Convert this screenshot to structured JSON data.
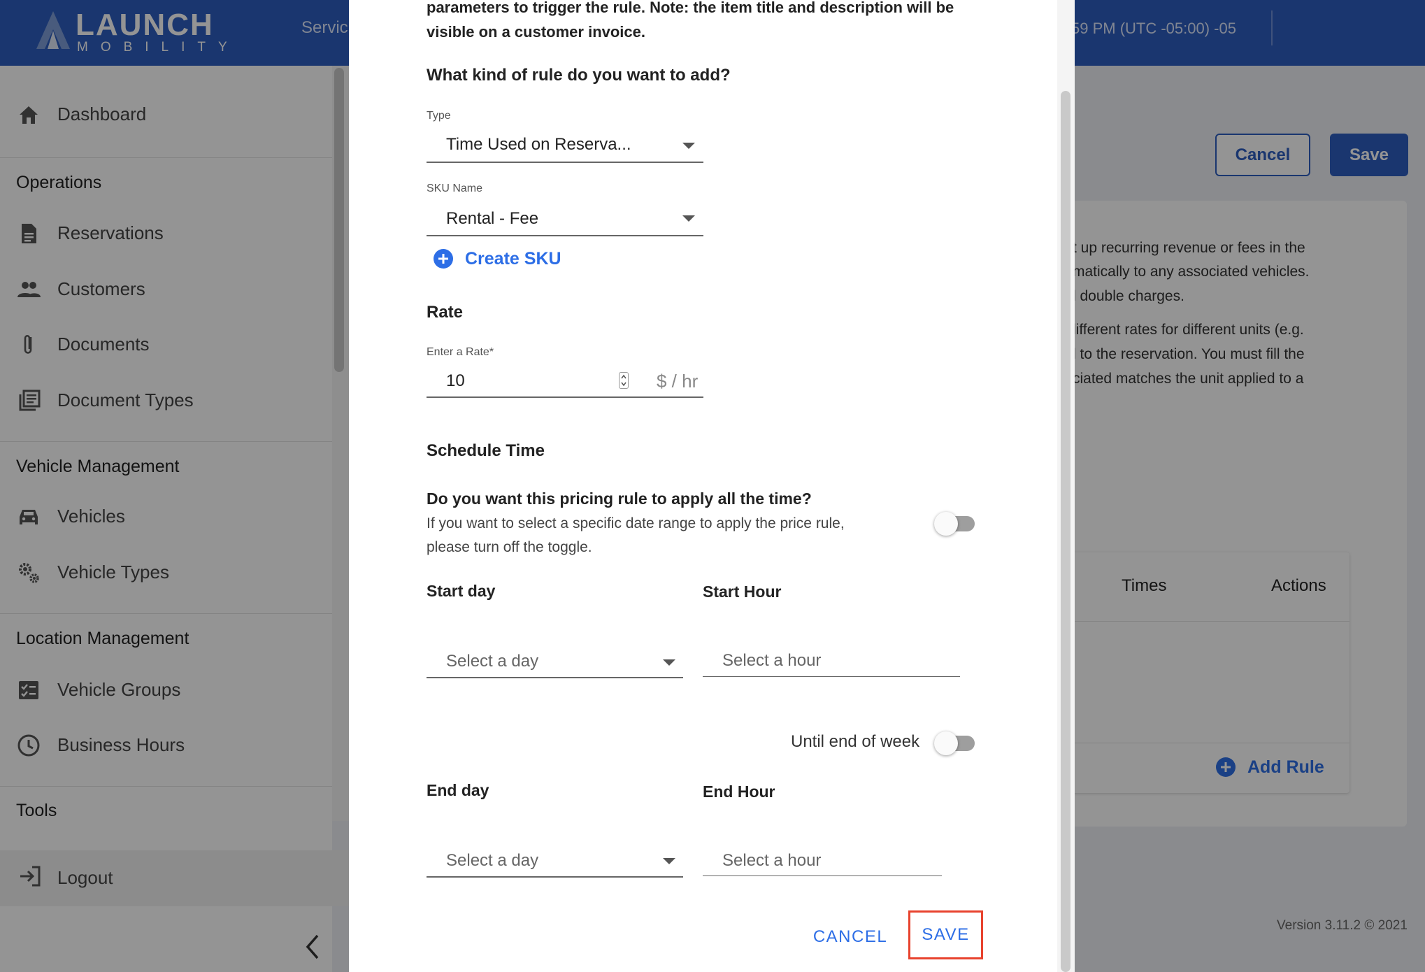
{
  "header": {
    "logo_word": "LAUNCH",
    "logo_sub": "MOBILITY",
    "service_text": "Servic",
    "time_text": "59 PM (UTC -05:00) -05",
    "brand_color": "#2d5ebf"
  },
  "sidebar": {
    "dashboard": "Dashboard",
    "operations_heading": "Operations",
    "operations_items": [
      {
        "label": "Reservations",
        "icon": "document-icon"
      },
      {
        "label": "Customers",
        "icon": "people-icon"
      },
      {
        "label": "Documents",
        "icon": "paperclip-icon"
      },
      {
        "label": "Document Types",
        "icon": "library-icon"
      }
    ],
    "vehicle_heading": "Vehicle Management",
    "vehicle_items": [
      {
        "label": "Vehicles",
        "icon": "car-icon"
      },
      {
        "label": "Vehicle Types",
        "icon": "gears-icon"
      }
    ],
    "location_heading": "Location Management",
    "location_items": [
      {
        "label": "Vehicle Groups",
        "icon": "checklist-icon"
      },
      {
        "label": "Business Hours",
        "icon": "clock-icon"
      }
    ],
    "tools_heading": "Tools",
    "logout": "Logout"
  },
  "background_page": {
    "cancel_label": "Cancel",
    "save_label": "Save",
    "description_lines": [
      "t up recurring revenue or fees in the",
      "matically to any associated vehicles.",
      "l double charges.",
      "lifferent rates for different units (e.g.",
      "l to the reservation. You must fill the",
      "ciated matches the unit applied to a"
    ],
    "table_headers": {
      "times": "Times",
      "actions": "Actions"
    },
    "add_rule_label": "Add Rule",
    "version": "Version 3.11.2 © 2021"
  },
  "modal": {
    "intro_lines": [
      "parameters to trigger the rule. Note: the item title and description will be",
      "visible on a customer invoice."
    ],
    "rule_kind_heading": "What kind of rule do you want to add?",
    "type_label": "Type",
    "type_value": "Time Used on Reserva...",
    "sku_label": "SKU Name",
    "sku_value": "Rental - Fee",
    "create_sku_label": "Create SKU",
    "rate_heading": "Rate",
    "rate_label": "Enter a Rate*",
    "rate_value": "10",
    "rate_unit": "$ / hr",
    "schedule_heading": "Schedule Time",
    "apply_question": "Do you want this pricing rule to apply all the time?",
    "apply_desc_lines": [
      "If you want to select a specific date range to apply the price rule,",
      "please turn off the toggle."
    ],
    "apply_all_time_on": false,
    "start_day_heading": "Start day",
    "start_day_placeholder": "Select a day",
    "start_hour_heading": "Start Hour",
    "start_hour_placeholder": "Select a hour",
    "until_end_label": "Until end of week",
    "until_end_on": false,
    "end_day_heading": "End day",
    "end_day_placeholder": "Select a day",
    "end_hour_heading": "End Hour",
    "end_hour_placeholder": "Select a hour",
    "cancel_label": "CANCEL",
    "save_label": "SAVE",
    "highlight_color": "#e8432e",
    "link_color": "#2d6ee6"
  }
}
